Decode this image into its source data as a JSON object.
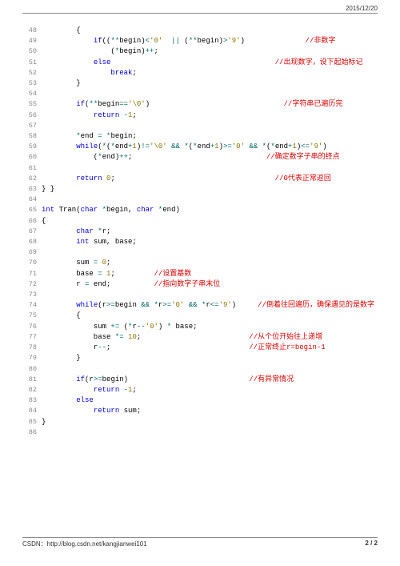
{
  "header": {
    "date": "2015/12/20"
  },
  "footer": {
    "source": "CSDN：http://blog.csdn.net/kangjianwei101",
    "page": "2 / 2"
  },
  "code": [
    {
      "n": 48,
      "t": [
        [
          "pl",
          "        {"
        ]
      ]
    },
    {
      "n": 49,
      "t": [
        [
          "pl",
          "            "
        ],
        [
          "kw",
          "if"
        ],
        [
          "pl",
          "(("
        ],
        [
          "op",
          "**"
        ],
        [
          "pl",
          "begin)"
        ],
        [
          "op",
          "<"
        ],
        [
          "ch",
          "'0'"
        ],
        [
          "pl",
          "  "
        ],
        [
          "op",
          "||"
        ],
        [
          "pl",
          " ("
        ],
        [
          "op",
          "**"
        ],
        [
          "pl",
          "begin)"
        ],
        [
          "op",
          ">"
        ],
        [
          "ch",
          "'9'"
        ],
        [
          "pl",
          ")              "
        ],
        [
          "cm",
          "//非数字"
        ]
      ]
    },
    {
      "n": 50,
      "t": [
        [
          "pl",
          "                ("
        ],
        [
          "op",
          "*"
        ],
        [
          "pl",
          "begin)"
        ],
        [
          "op",
          "++"
        ],
        [
          "pl",
          ";"
        ]
      ]
    },
    {
      "n": 51,
      "t": [
        [
          "pl",
          "            "
        ],
        [
          "kw",
          "else"
        ],
        [
          "pl",
          "                                      "
        ],
        [
          "cm",
          "//出现数字，设下起始标记"
        ]
      ]
    },
    {
      "n": 52,
      "t": [
        [
          "pl",
          "                "
        ],
        [
          "kw",
          "break"
        ],
        [
          "pl",
          ";"
        ]
      ]
    },
    {
      "n": 53,
      "t": [
        [
          "pl",
          "        }"
        ]
      ]
    },
    {
      "n": 54,
      "t": [
        [
          "pl",
          ""
        ]
      ]
    },
    {
      "n": 55,
      "t": [
        [
          "pl",
          "        "
        ],
        [
          "kw",
          "if"
        ],
        [
          "pl",
          "("
        ],
        [
          "op",
          "**"
        ],
        [
          "pl",
          "begin"
        ],
        [
          "op",
          "=="
        ],
        [
          "ch",
          "'\\0'"
        ],
        [
          "pl",
          ")                               "
        ],
        [
          "cm",
          "//字符串已遍历完"
        ]
      ]
    },
    {
      "n": 56,
      "t": [
        [
          "pl",
          "            "
        ],
        [
          "kw",
          "return"
        ],
        [
          "pl",
          " "
        ],
        [
          "op",
          "-"
        ],
        [
          "num",
          "1"
        ],
        [
          "pl",
          ";"
        ]
      ]
    },
    {
      "n": 57,
      "t": [
        [
          "pl",
          ""
        ]
      ]
    },
    {
      "n": 58,
      "t": [
        [
          "pl",
          "        "
        ],
        [
          "op",
          "*"
        ],
        [
          "pl",
          "end "
        ],
        [
          "op",
          "="
        ],
        [
          "pl",
          " "
        ],
        [
          "op",
          "*"
        ],
        [
          "pl",
          "begin;"
        ]
      ]
    },
    {
      "n": 59,
      "t": [
        [
          "pl",
          "        "
        ],
        [
          "kw",
          "while"
        ],
        [
          "pl",
          "("
        ],
        [
          "op",
          "*"
        ],
        [
          "pl",
          "("
        ],
        [
          "op",
          "*"
        ],
        [
          "pl",
          "end"
        ],
        [
          "op",
          "+"
        ],
        [
          "num",
          "1"
        ],
        [
          "pl",
          ")"
        ],
        [
          "op",
          "!="
        ],
        [
          "ch",
          "'\\0'"
        ],
        [
          "pl",
          " "
        ],
        [
          "op",
          "&&"
        ],
        [
          "pl",
          " "
        ],
        [
          "op",
          "*"
        ],
        [
          "pl",
          "("
        ],
        [
          "op",
          "*"
        ],
        [
          "pl",
          "end"
        ],
        [
          "op",
          "+"
        ],
        [
          "num",
          "1"
        ],
        [
          "pl",
          ")"
        ],
        [
          "op",
          ">="
        ],
        [
          "ch",
          "'0'"
        ],
        [
          "pl",
          " "
        ],
        [
          "op",
          "&&"
        ],
        [
          "pl",
          " "
        ],
        [
          "op",
          "*"
        ],
        [
          "pl",
          "("
        ],
        [
          "op",
          "*"
        ],
        [
          "pl",
          "end"
        ],
        [
          "op",
          "+"
        ],
        [
          "num",
          "1"
        ],
        [
          "pl",
          ")"
        ],
        [
          "op",
          "<="
        ],
        [
          "ch",
          "'9'"
        ],
        [
          "pl",
          ")"
        ]
      ]
    },
    {
      "n": 60,
      "t": [
        [
          "pl",
          "            ("
        ],
        [
          "op",
          "*"
        ],
        [
          "pl",
          "end)"
        ],
        [
          "op",
          "++"
        ],
        [
          "pl",
          ";                               "
        ],
        [
          "cm",
          "//确定数字子串的终点"
        ]
      ]
    },
    {
      "n": 61,
      "t": [
        [
          "pl",
          ""
        ]
      ]
    },
    {
      "n": 62,
      "t": [
        [
          "pl",
          "        "
        ],
        [
          "kw",
          "return"
        ],
        [
          "pl",
          " "
        ],
        [
          "num",
          "0"
        ],
        [
          "pl",
          ";                                     "
        ],
        [
          "cm",
          "//0代表正常返回"
        ]
      ]
    },
    {
      "n": 63,
      "t": [
        [
          "pl",
          "} }"
        ]
      ]
    },
    {
      "n": 64,
      "t": [
        [
          "pl",
          ""
        ]
      ]
    },
    {
      "n": 65,
      "t": [
        [
          "kw",
          "int"
        ],
        [
          "pl",
          " Tran("
        ],
        [
          "kw",
          "char"
        ],
        [
          "pl",
          " "
        ],
        [
          "op",
          "*"
        ],
        [
          "pl",
          "begin, "
        ],
        [
          "kw",
          "char"
        ],
        [
          "pl",
          " "
        ],
        [
          "op",
          "*"
        ],
        [
          "pl",
          "end)"
        ]
      ]
    },
    {
      "n": 66,
      "t": [
        [
          "pl",
          "{"
        ]
      ]
    },
    {
      "n": 67,
      "t": [
        [
          "pl",
          "        "
        ],
        [
          "kw",
          "char"
        ],
        [
          "pl",
          " "
        ],
        [
          "op",
          "*"
        ],
        [
          "pl",
          "r;"
        ]
      ]
    },
    {
      "n": 68,
      "t": [
        [
          "pl",
          "        "
        ],
        [
          "kw",
          "int"
        ],
        [
          "pl",
          " sum, base;"
        ]
      ]
    },
    {
      "n": 69,
      "t": [
        [
          "pl",
          ""
        ]
      ]
    },
    {
      "n": 70,
      "t": [
        [
          "pl",
          "        sum "
        ],
        [
          "op",
          "="
        ],
        [
          "pl",
          " "
        ],
        [
          "num",
          "0"
        ],
        [
          "pl",
          ";"
        ]
      ]
    },
    {
      "n": 71,
      "t": [
        [
          "pl",
          "        base "
        ],
        [
          "op",
          "="
        ],
        [
          "pl",
          " "
        ],
        [
          "num",
          "1"
        ],
        [
          "pl",
          ";         "
        ],
        [
          "cm",
          "//设置基数"
        ]
      ]
    },
    {
      "n": 72,
      "t": [
        [
          "pl",
          "        r "
        ],
        [
          "op",
          "="
        ],
        [
          "pl",
          " end;          "
        ],
        [
          "cm",
          "//指向数字子串末位"
        ]
      ]
    },
    {
      "n": 73,
      "t": [
        [
          "pl",
          ""
        ]
      ]
    },
    {
      "n": 74,
      "t": [
        [
          "pl",
          "        "
        ],
        [
          "kw",
          "while"
        ],
        [
          "pl",
          "(r"
        ],
        [
          "op",
          ">="
        ],
        [
          "pl",
          "begin "
        ],
        [
          "op",
          "&&"
        ],
        [
          "pl",
          " "
        ],
        [
          "op",
          "*"
        ],
        [
          "pl",
          "r"
        ],
        [
          "op",
          ">="
        ],
        [
          "ch",
          "'0'"
        ],
        [
          "pl",
          " "
        ],
        [
          "op",
          "&&"
        ],
        [
          "pl",
          " "
        ],
        [
          "op",
          "*"
        ],
        [
          "pl",
          "r"
        ],
        [
          "op",
          "<="
        ],
        [
          "ch",
          "'9'"
        ],
        [
          "pl",
          ")     "
        ],
        [
          "cm",
          "//倒着往回遍历，确保遇见的是数字"
        ]
      ]
    },
    {
      "n": 75,
      "t": [
        [
          "pl",
          "        {"
        ]
      ]
    },
    {
      "n": 76,
      "t": [
        [
          "pl",
          "            sum "
        ],
        [
          "op",
          "+="
        ],
        [
          "pl",
          " ("
        ],
        [
          "op",
          "*"
        ],
        [
          "pl",
          "r"
        ],
        [
          "op",
          "--"
        ],
        [
          "ch",
          "'0'"
        ],
        [
          "pl",
          ") "
        ],
        [
          "op",
          "*"
        ],
        [
          "pl",
          " base;"
        ]
      ]
    },
    {
      "n": 77,
      "t": [
        [
          "pl",
          "            base "
        ],
        [
          "op",
          "*="
        ],
        [
          "pl",
          " "
        ],
        [
          "num",
          "10"
        ],
        [
          "pl",
          ";                         "
        ],
        [
          "cm",
          "//从个位开始往上递增"
        ]
      ]
    },
    {
      "n": 78,
      "t": [
        [
          "pl",
          "            r"
        ],
        [
          "op",
          "--"
        ],
        [
          "pl",
          ";                                "
        ],
        [
          "cm",
          "//正常终止r=begin-1"
        ]
      ]
    },
    {
      "n": 79,
      "t": [
        [
          "pl",
          "        }"
        ]
      ]
    },
    {
      "n": 80,
      "t": [
        [
          "pl",
          ""
        ]
      ]
    },
    {
      "n": 81,
      "t": [
        [
          "pl",
          "        "
        ],
        [
          "kw",
          "if"
        ],
        [
          "pl",
          "(r"
        ],
        [
          "op",
          ">="
        ],
        [
          "pl",
          "begin)                            "
        ],
        [
          "cm",
          "//有异常情况"
        ]
      ]
    },
    {
      "n": 82,
      "t": [
        [
          "pl",
          "            "
        ],
        [
          "kw",
          "return"
        ],
        [
          "pl",
          " "
        ],
        [
          "op",
          "-"
        ],
        [
          "num",
          "1"
        ],
        [
          "pl",
          ";"
        ]
      ]
    },
    {
      "n": 83,
      "t": [
        [
          "pl",
          "        "
        ],
        [
          "kw",
          "else"
        ]
      ]
    },
    {
      "n": 84,
      "t": [
        [
          "pl",
          "            "
        ],
        [
          "kw",
          "return"
        ],
        [
          "pl",
          " sum;"
        ]
      ]
    },
    {
      "n": 85,
      "t": [
        [
          "pl",
          "}"
        ]
      ]
    },
    {
      "n": 86,
      "t": [
        [
          "pl",
          ""
        ]
      ]
    }
  ]
}
